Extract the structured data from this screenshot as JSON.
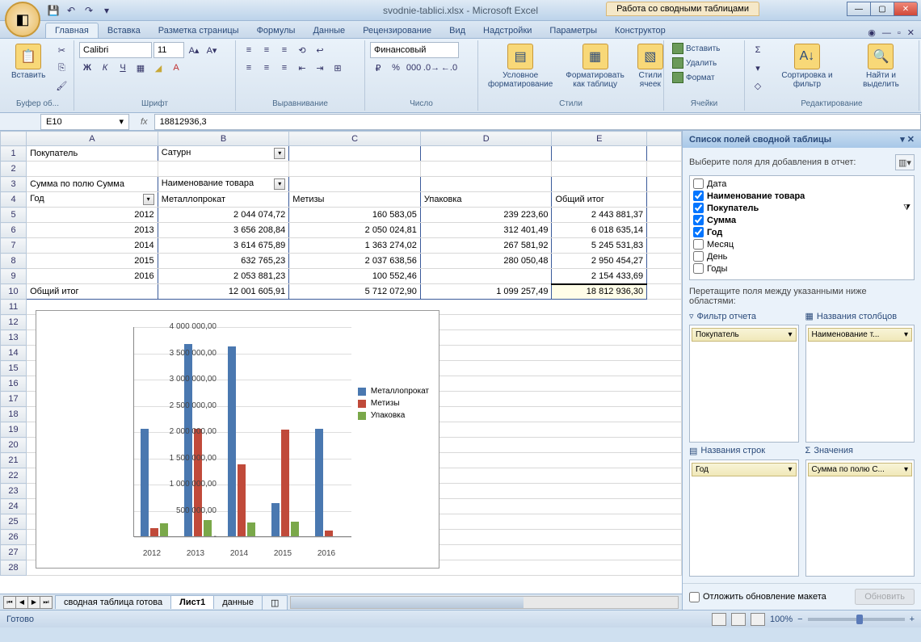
{
  "window": {
    "title": "svodnie-tablici.xlsx - Microsoft Excel",
    "context_tab": "Работа со сводными таблицами"
  },
  "ribbon": {
    "tabs": [
      "Главная",
      "Вставка",
      "Разметка страницы",
      "Формулы",
      "Данные",
      "Рецензирование",
      "Вид",
      "Надстройки",
      "Параметры",
      "Конструктор"
    ],
    "active": 0,
    "groups": {
      "clipboard": "Буфер об...",
      "font": "Шрифт",
      "alignment": "Выравнивание",
      "number": "Число",
      "styles": "Стили",
      "cells": "Ячейки",
      "editing": "Редактирование"
    },
    "paste": "Вставить",
    "font_name": "Calibri",
    "font_size": "11",
    "number_format": "Финансовый",
    "cond_fmt": "Условное форматирование",
    "fmt_table": "Форматировать как таблицу",
    "cell_styles": "Стили ячеек",
    "insert": "Вставить",
    "delete": "Удалить",
    "format": "Формат",
    "sort": "Сортировка и фильтр",
    "find": "Найти и выделить"
  },
  "formula_bar": {
    "name_box": "E10",
    "formula": "18812936,3"
  },
  "columns": [
    "A",
    "B",
    "C",
    "D",
    "E"
  ],
  "pivot": {
    "filter_label": "Покупатель",
    "filter_value": "Сатурн",
    "measure_label": "Сумма по полю Сумма",
    "col_field": "Наименование товара",
    "row_field": "Год",
    "col_headers": [
      "Металлопрокат",
      "Метизы",
      "Упаковка",
      "Общий итог"
    ],
    "rows": [
      {
        "year": "2012",
        "v": [
          "2 044 074,72",
          "160 583,05",
          "239 223,60",
          "2 443 881,37"
        ]
      },
      {
        "year": "2013",
        "v": [
          "3 656 208,84",
          "2 050 024,81",
          "312 401,49",
          "6 018 635,14"
        ]
      },
      {
        "year": "2014",
        "v": [
          "3 614 675,89",
          "1 363 274,02",
          "267 581,92",
          "5 245 531,83"
        ]
      },
      {
        "year": "2015",
        "v": [
          "632 765,23",
          "2 037 638,56",
          "280 050,48",
          "2 950 454,27"
        ]
      },
      {
        "year": "2016",
        "v": [
          "2 053 881,23",
          "100 552,46",
          "",
          "2 154 433,69"
        ]
      }
    ],
    "grand_label": "Общий итог",
    "grand": [
      "12 001 605,91",
      "5 712 072,90",
      "1 099 257,49",
      "18 812 936,30"
    ]
  },
  "chart_data": {
    "type": "bar",
    "categories": [
      "2012",
      "2013",
      "2014",
      "2015",
      "2016"
    ],
    "series": [
      {
        "name": "Металлопрокат",
        "color": "#4a78b0",
        "values": [
          2044074.72,
          3656208.84,
          3614675.89,
          632765.23,
          2053881.23
        ]
      },
      {
        "name": "Метизы",
        "color": "#c04a3a",
        "values": [
          160583.05,
          2050024.81,
          1363274.02,
          2037638.56,
          100552.46
        ]
      },
      {
        "name": "Упаковка",
        "color": "#7aa84a",
        "values": [
          239223.6,
          312401.49,
          267581.92,
          280050.48,
          0
        ]
      }
    ],
    "ylim": [
      0,
      4000000
    ],
    "yticks": [
      "-",
      "500 000,00",
      "1 000 000,00",
      "1 500 000,00",
      "2 000 000,00",
      "2 500 000,00",
      "3 000 000,00",
      "3 500 000,00",
      "4 000 000,00"
    ]
  },
  "sheet_tabs": {
    "tabs": [
      "сводная таблица готова",
      "Лист1",
      "данные"
    ],
    "active": 1
  },
  "field_panel": {
    "title": "Список полей сводной таблицы",
    "hint": "Выберите поля для добавления в отчет:",
    "fields": [
      {
        "name": "Дата",
        "checked": false
      },
      {
        "name": "Наименование товара",
        "checked": true
      },
      {
        "name": "Покупатель",
        "checked": true,
        "filtered": true
      },
      {
        "name": "Сумма",
        "checked": true
      },
      {
        "name": "Год",
        "checked": true
      },
      {
        "name": "Месяц",
        "checked": false
      },
      {
        "name": "День",
        "checked": false
      },
      {
        "name": "Годы",
        "checked": false
      }
    ],
    "areas_hint": "Перетащите поля между указанными ниже областями:",
    "area_labels": {
      "filter": "Фильтр отчета",
      "cols": "Названия столбцов",
      "rows": "Названия строк",
      "vals": "Значения"
    },
    "areas": {
      "filter": [
        "Покупатель"
      ],
      "cols": [
        "Наименование т..."
      ],
      "rows": [
        "Год"
      ],
      "vals": [
        "Сумма по полю С..."
      ]
    },
    "defer": "Отложить обновление макета",
    "update": "Обновить"
  },
  "status": {
    "ready": "Готово",
    "zoom": "100%"
  }
}
